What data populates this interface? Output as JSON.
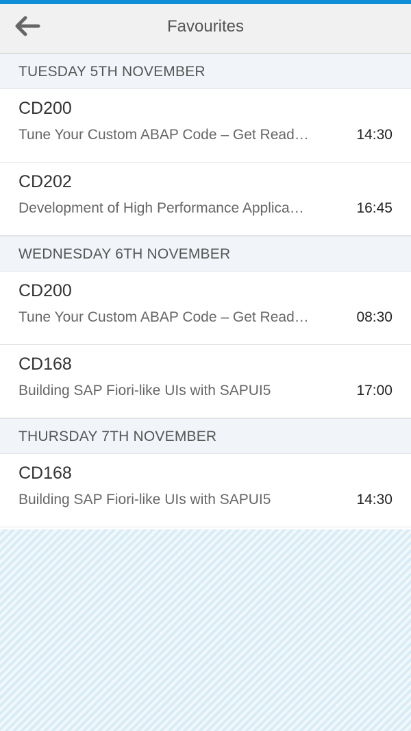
{
  "header": {
    "title": "Favourites",
    "back_icon": "arrow-left-icon",
    "accent_color": "#0e8fd6"
  },
  "groups": [
    {
      "label": "TUESDAY 5TH NOVEMBER",
      "items": [
        {
          "code": "CD200",
          "title": "Tune Your Custom ABAP Code – Get Read…",
          "time": "14:30"
        },
        {
          "code": "CD202",
          "title": "Development of High Performance Applica…",
          "time": "16:45"
        }
      ]
    },
    {
      "label": "WEDNESDAY 6TH NOVEMBER",
      "items": [
        {
          "code": "CD200",
          "title": "Tune Your Custom ABAP Code – Get Read…",
          "time": "08:30"
        },
        {
          "code": "CD168",
          "title": "Building SAP Fiori-like UIs with SAPUI5",
          "time": "17:00"
        }
      ]
    },
    {
      "label": "THURSDAY 7TH NOVEMBER",
      "items": [
        {
          "code": "CD168",
          "title": "Building SAP Fiori-like UIs with SAPUI5",
          "time": "14:30"
        }
      ]
    }
  ]
}
